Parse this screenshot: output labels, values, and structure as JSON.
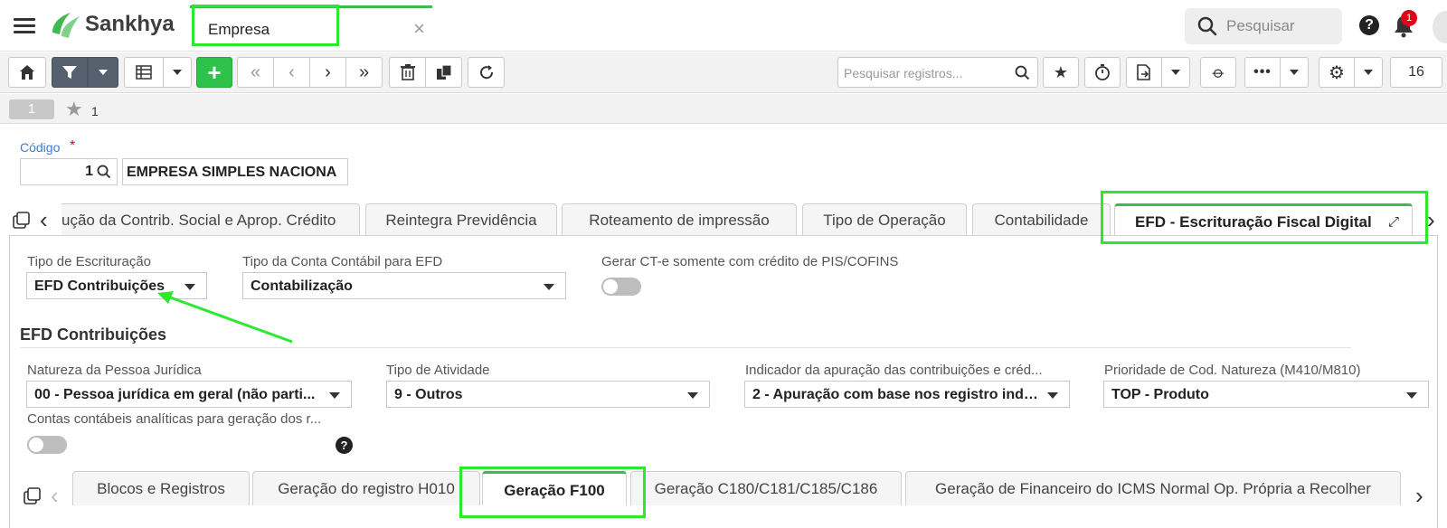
{
  "app": {
    "brand": "Sankhya",
    "open_tab": "Empresa",
    "global_search_placeholder": "Pesquisar",
    "notification_count": "1"
  },
  "toolbar": {
    "record_search_placeholder": "Pesquisar registros...",
    "page_size": "16"
  },
  "record_bar": {
    "record_index": "1",
    "favorites_count": "1"
  },
  "form": {
    "codigo_label": "Código",
    "required_mark": "*",
    "codigo_value": "1",
    "empresa_name": "EMPRESA SIMPLES NACIONA"
  },
  "main_tabs": [
    {
      "label": "ução da Contrib. Social e Aprop. Crédito"
    },
    {
      "label": "Reintegra Previdência"
    },
    {
      "label": "Roteamento de impressão"
    },
    {
      "label": "Tipo de Operação"
    },
    {
      "label": "Contabilidade"
    },
    {
      "label": "EFD - Escrituração Fiscal Digital"
    }
  ],
  "efd": {
    "tipo_escrituracao_label": "Tipo de Escrituração",
    "tipo_escrituracao_value": "EFD Contribuições",
    "tipo_conta_label": "Tipo da Conta Contábil para EFD",
    "tipo_conta_value": "Contabilização",
    "gerar_cte_label": "Gerar CT-e somente com crédito de PIS/COFINS",
    "gerar_cte_on": false,
    "section_title": "EFD Contribuições",
    "natureza_label": "Natureza da Pessoa Jurídica",
    "natureza_value": "00 - Pessoa jurídica em geral (não parti...",
    "tipo_atividade_label": "Tipo de Atividade",
    "tipo_atividade_value": "9 - Outros",
    "indicador_label": "Indicador da apuração das contribuições e créd...",
    "indicador_value": "2 - Apuração com base nos registro indi...",
    "prioridade_label": "Prioridade de Cod. Natureza (M410/M810)",
    "prioridade_value": "TOP - Produto",
    "contas_label": "Contas contábeis analíticas para geração dos r...",
    "contas_on": false,
    "help_glyph": "?"
  },
  "sub_tabs": [
    {
      "label": "Blocos e Registros"
    },
    {
      "label": "Geração do registro H010"
    },
    {
      "label": "Geração F100"
    },
    {
      "label": "Geração C180/C181/C185/C186"
    },
    {
      "label": "Geração de Financeiro do ICMS Normal Op. Própria a Recolher"
    }
  ],
  "colors": {
    "accent_green": "#3fb950",
    "highlight_green": "#2ee830",
    "link_blue": "#3b7bd4",
    "badge_red": "#e0001a"
  }
}
